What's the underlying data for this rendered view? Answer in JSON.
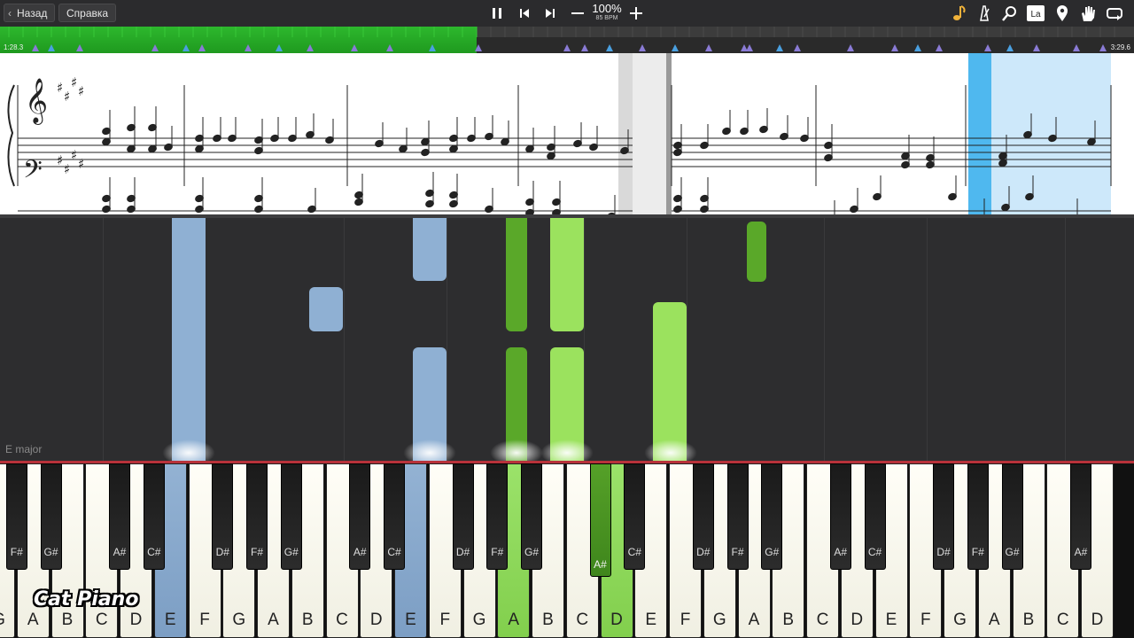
{
  "topbar": {
    "back_label": "Назад",
    "help_label": "Справка",
    "tempo_percent": "100%",
    "tempo_bpm": "85 BPM",
    "labels_icon_text": "La"
  },
  "timeline": {
    "current_time": "1:28.3",
    "total_time": "3:29.6",
    "progress_fraction": 0.42
  },
  "roll": {
    "key_signature": "E major"
  },
  "keyboard": {
    "white_keys": [
      "G",
      "A",
      "B",
      "C",
      "D",
      "E",
      "F",
      "G",
      "A",
      "B",
      "C",
      "D",
      "E",
      "F",
      "G",
      "A",
      "B",
      "C",
      "D",
      "E",
      "F",
      "G",
      "A",
      "B",
      "C",
      "D",
      "E",
      "F",
      "G",
      "A",
      "B",
      "C",
      "D"
    ],
    "black_keys": [
      "F#",
      "G#",
      "A#",
      "C#",
      "D#",
      "F#",
      "G#",
      "A#",
      "C#",
      "D#",
      "F#",
      "G#",
      "A#",
      "C#",
      "D#",
      "F#",
      "G#",
      "A#",
      "C#",
      "D#",
      "F#",
      "G#",
      "A#",
      "C#",
      "D#"
    ]
  },
  "watermark": "Cat Piano",
  "colors": {
    "left_hand": "#8fb0d3",
    "right_hand_dark": "#5aa829",
    "right_hand_light": "#9be25e",
    "progress": "#22a822",
    "highlight": "#4fb8ef"
  }
}
